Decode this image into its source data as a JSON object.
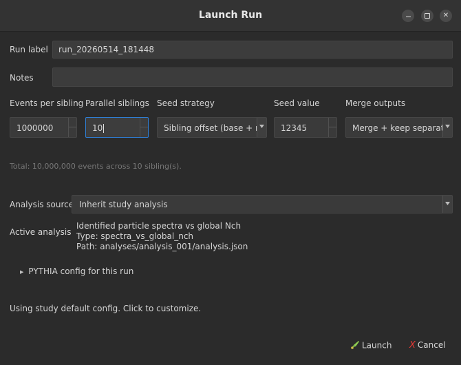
{
  "window": {
    "title": "Launch Run"
  },
  "run_label": {
    "label": "Run label",
    "value": "run_20260514_181448"
  },
  "notes": {
    "label": "Notes",
    "value": ""
  },
  "events_per_sibling": {
    "label": "Events per sibling",
    "value": "1000000"
  },
  "parallel_siblings": {
    "label": "Parallel siblings",
    "value": "10"
  },
  "seed_strategy": {
    "label": "Seed strategy",
    "value": "Sibling offset (base + n)"
  },
  "seed_value": {
    "label": "Seed value",
    "value": "12345"
  },
  "merge_outputs": {
    "label": "Merge outputs",
    "value": "Merge + keep separate"
  },
  "summary": "Total: 10,000,000 events across 10 sibling(s).",
  "analysis_source": {
    "label": "Analysis source",
    "value": "Inherit study analysis"
  },
  "active_analysis": {
    "label": "Active analysis",
    "name": "Identified particle spectra vs global Nch",
    "type": "Type: spectra_vs_global_nch",
    "path": "Path: analyses/analysis_001/analysis.json"
  },
  "pythia_section": {
    "label": "PYTHIA config for this run"
  },
  "config_status": "Using study default config. Click to customize.",
  "actions": {
    "launch": "Launch",
    "cancel": "Cancel"
  },
  "colors": {
    "launch_icon": "#79b844",
    "cancel_icon": "#e53935",
    "focus": "#2f7fd6"
  }
}
